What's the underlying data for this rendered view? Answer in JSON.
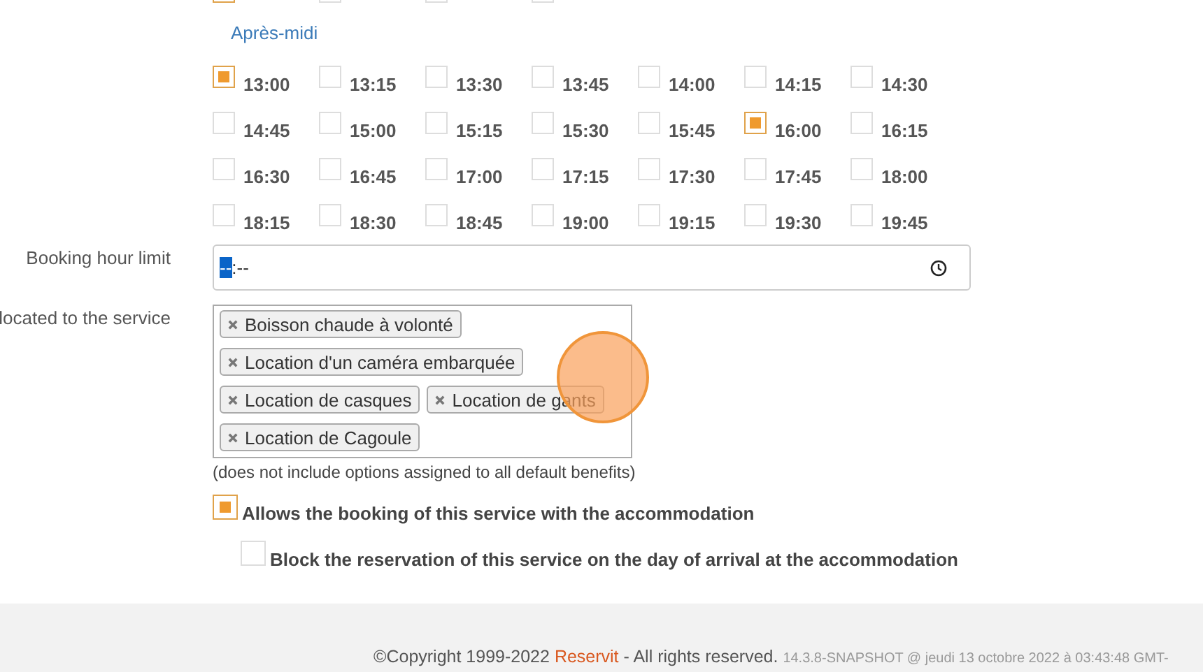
{
  "top_slots": [
    {
      "checked": true
    },
    {
      "checked": false
    },
    {
      "checked": false
    },
    {
      "checked": false
    }
  ],
  "section_title": "Après-midi",
  "slots": [
    {
      "time": "13:00",
      "checked": true
    },
    {
      "time": "13:15",
      "checked": false
    },
    {
      "time": "13:30",
      "checked": false
    },
    {
      "time": "13:45",
      "checked": false
    },
    {
      "time": "14:00",
      "checked": false
    },
    {
      "time": "14:15",
      "checked": false
    },
    {
      "time": "14:30",
      "checked": false
    },
    {
      "time": "14:45",
      "checked": false
    },
    {
      "time": "15:00",
      "checked": false
    },
    {
      "time": "15:15",
      "checked": false
    },
    {
      "time": "15:30",
      "checked": false
    },
    {
      "time": "15:45",
      "checked": false
    },
    {
      "time": "16:00",
      "checked": true
    },
    {
      "time": "16:15",
      "checked": false
    },
    {
      "time": "16:30",
      "checked": false
    },
    {
      "time": "16:45",
      "checked": false
    },
    {
      "time": "17:00",
      "checked": false
    },
    {
      "time": "17:15",
      "checked": false
    },
    {
      "time": "17:30",
      "checked": false
    },
    {
      "time": "17:45",
      "checked": false
    },
    {
      "time": "18:00",
      "checked": false
    },
    {
      "time": "18:15",
      "checked": false
    },
    {
      "time": "18:30",
      "checked": false
    },
    {
      "time": "18:45",
      "checked": false
    },
    {
      "time": "19:00",
      "checked": false
    },
    {
      "time": "19:15",
      "checked": false
    },
    {
      "time": "19:30",
      "checked": false
    },
    {
      "time": "19:45",
      "checked": false
    }
  ],
  "booking_hour_limit": {
    "label": "Booking hour limit",
    "hours": "--",
    "separator": ":",
    "minutes": "--"
  },
  "options": {
    "label": "located to the service",
    "tags": [
      "Boisson chaude à volonté",
      "Location d'un caméra embarquée",
      "Location de casques",
      "Location de gants",
      "Location de Cagoule"
    ],
    "note": "(does not include options assigned to all default benefits)"
  },
  "checkboxes": [
    {
      "label": "Allows the booking of this service with the accommodation",
      "checked": true,
      "children": [
        {
          "label": "Block the reservation of this service on the day of arrival at the accommodation",
          "checked": false
        }
      ]
    }
  ],
  "footer": {
    "copyright": "©Copyright 1999-2022",
    "brand": "Reservit",
    "rights": "- All rights reserved.",
    "version": "14.3.8-SNAPSHOT @ jeudi 13 octobre 2022 à 03:43:48 GMT-"
  }
}
